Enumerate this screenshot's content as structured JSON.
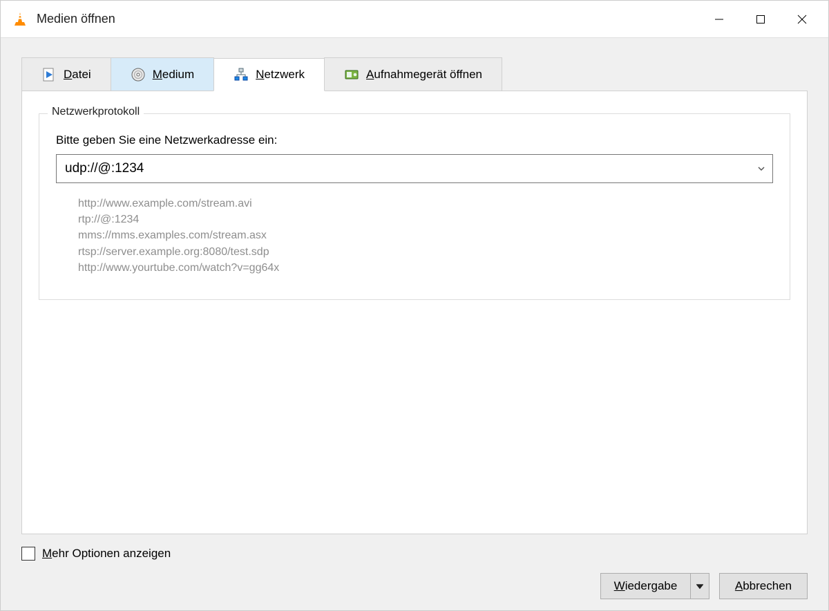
{
  "window": {
    "title": "Medien öffnen"
  },
  "tabs": {
    "file": {
      "pre": "",
      "u": "D",
      "post": "atei"
    },
    "disc": {
      "pre": "",
      "u": "M",
      "post": "edium"
    },
    "network": {
      "pre": "",
      "u": "N",
      "post": "etzwerk"
    },
    "capture": {
      "pre": "",
      "u": "A",
      "post": "ufnahmegerät öffnen"
    }
  },
  "group": {
    "legend": "Netzwerkprotokoll",
    "prompt": "Bitte geben Sie eine Netzwerkadresse ein:",
    "url_value": "udp://@:1234",
    "examples": [
      "http://www.example.com/stream.avi",
      "rtp://@:1234",
      "mms://mms.examples.com/stream.asx",
      "rtsp://server.example.org:8080/test.sdp",
      "http://www.yourtube.com/watch?v=gg64x"
    ]
  },
  "more_options": {
    "pre": "",
    "u": "M",
    "post": "ehr Optionen anzeigen"
  },
  "buttons": {
    "play": {
      "pre": "",
      "u": "W",
      "post": "iedergabe"
    },
    "cancel": {
      "pre": "",
      "u": "A",
      "post": "bbrechen"
    }
  }
}
